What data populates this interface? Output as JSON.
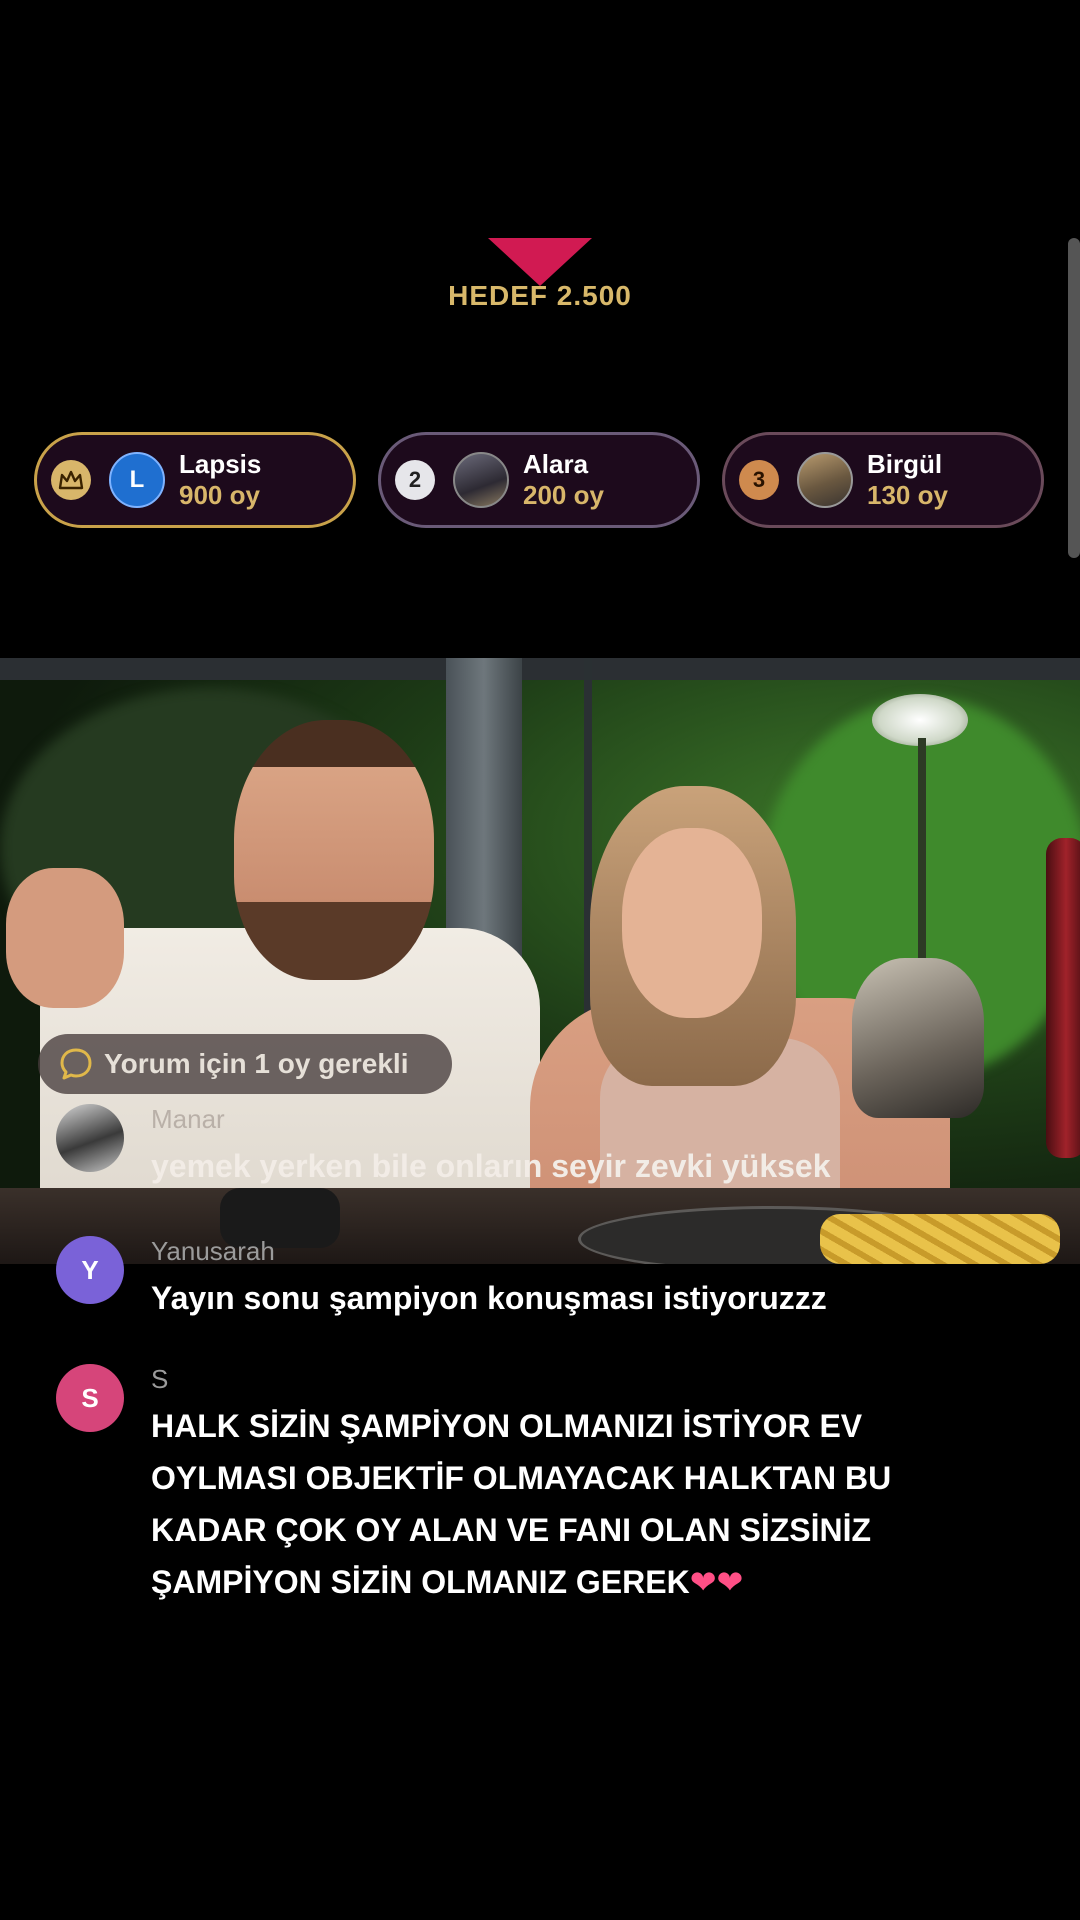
{
  "goal": {
    "label": "HEDEF 2.500",
    "marker_color": "#d11a52"
  },
  "leaderboard": [
    {
      "rank": "crown",
      "avatar": "L",
      "name": "Lapsis",
      "votes": "900 oy"
    },
    {
      "rank": "2",
      "avatar": "photo",
      "name": "Alara",
      "votes": "200 oy"
    },
    {
      "rank": "3",
      "avatar": "photo",
      "name": "Birgül",
      "votes": "130 oy"
    }
  ],
  "comment_requirement": "Yorum için 1 oy gerekli",
  "chat": [
    {
      "avatar": "photo",
      "user": "Manar",
      "text": "yemek yerken bile onların seyir zevki yüksek"
    },
    {
      "avatar": "Y",
      "user": "Yanusarah",
      "text": "Yayın sonu şampiyon konuşması istiyoruzzz"
    },
    {
      "avatar": "S",
      "user": "S",
      "text": "HALK SİZİN ŞAMPİYON OLMANIZI İSTİYOR EV OYLMASI OBJEKTİF OLMAYACAK HALKTAN BU KADAR ÇOK OY ALAN VE FANI OLAN SİZSİNİZ ŞAMPİYON SİZİN OLMANIZ GEREK",
      "hearts": "❤❤"
    }
  ],
  "colors": {
    "gold": "#d8b66a",
    "accent": "#d11a52",
    "avatar_y": "#7a62d8",
    "avatar_s": "#d6457a"
  }
}
